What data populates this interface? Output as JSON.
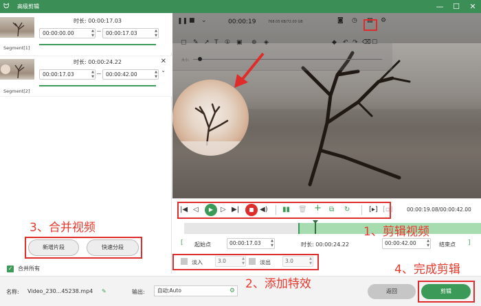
{
  "window": {
    "title": "高级剪辑",
    "controls": [
      "—",
      "☐",
      "✕"
    ]
  },
  "segments": [
    {
      "label": "Segment[1]",
      "duration_label": "时长:",
      "duration": "00:00:17.03",
      "start": "00:00:00.00",
      "end": "00:00:17.03"
    },
    {
      "label": "Segment[2]",
      "duration_label": "时长:",
      "duration": "00:00:24.22",
      "start": "00:00:17.03",
      "end": "00:00:42.00"
    }
  ],
  "segment_actions": {
    "new": "新增片段",
    "split": "快速分段"
  },
  "merge_all": {
    "label": "合并所有",
    "checked": true
  },
  "player": {
    "current_time": "00:00:19",
    "storage": "768.05 KB/72.00 GB",
    "size_label": "大小:",
    "timecode": "00:00:19.08/00:00:42.00"
  },
  "range": {
    "start_label": "起始点",
    "start": "00:00:17.03",
    "duration_label": "时长:",
    "duration": "00:00:24.22",
    "end": "00:00:42.00",
    "end_label": "结束点"
  },
  "fade": {
    "in_label": "淡入",
    "in_value": "3.0",
    "out_label": "淡出",
    "out_value": "3.0"
  },
  "bottom": {
    "name_label": "名称:",
    "filename": "Video_230...45238.mp4",
    "output_label": "输出:",
    "output_value": "自动;Auto",
    "back": "返回",
    "cut": "剪辑"
  },
  "annotations": {
    "step1": "1、剪辑视频",
    "step2": "2、添加特效",
    "step3": "3、合并视频",
    "step4": "4、完成剪辑"
  },
  "colors": {
    "brand": "#3b8e56",
    "accent_green": "#3c9a58",
    "annotation_red": "#e8382c"
  }
}
